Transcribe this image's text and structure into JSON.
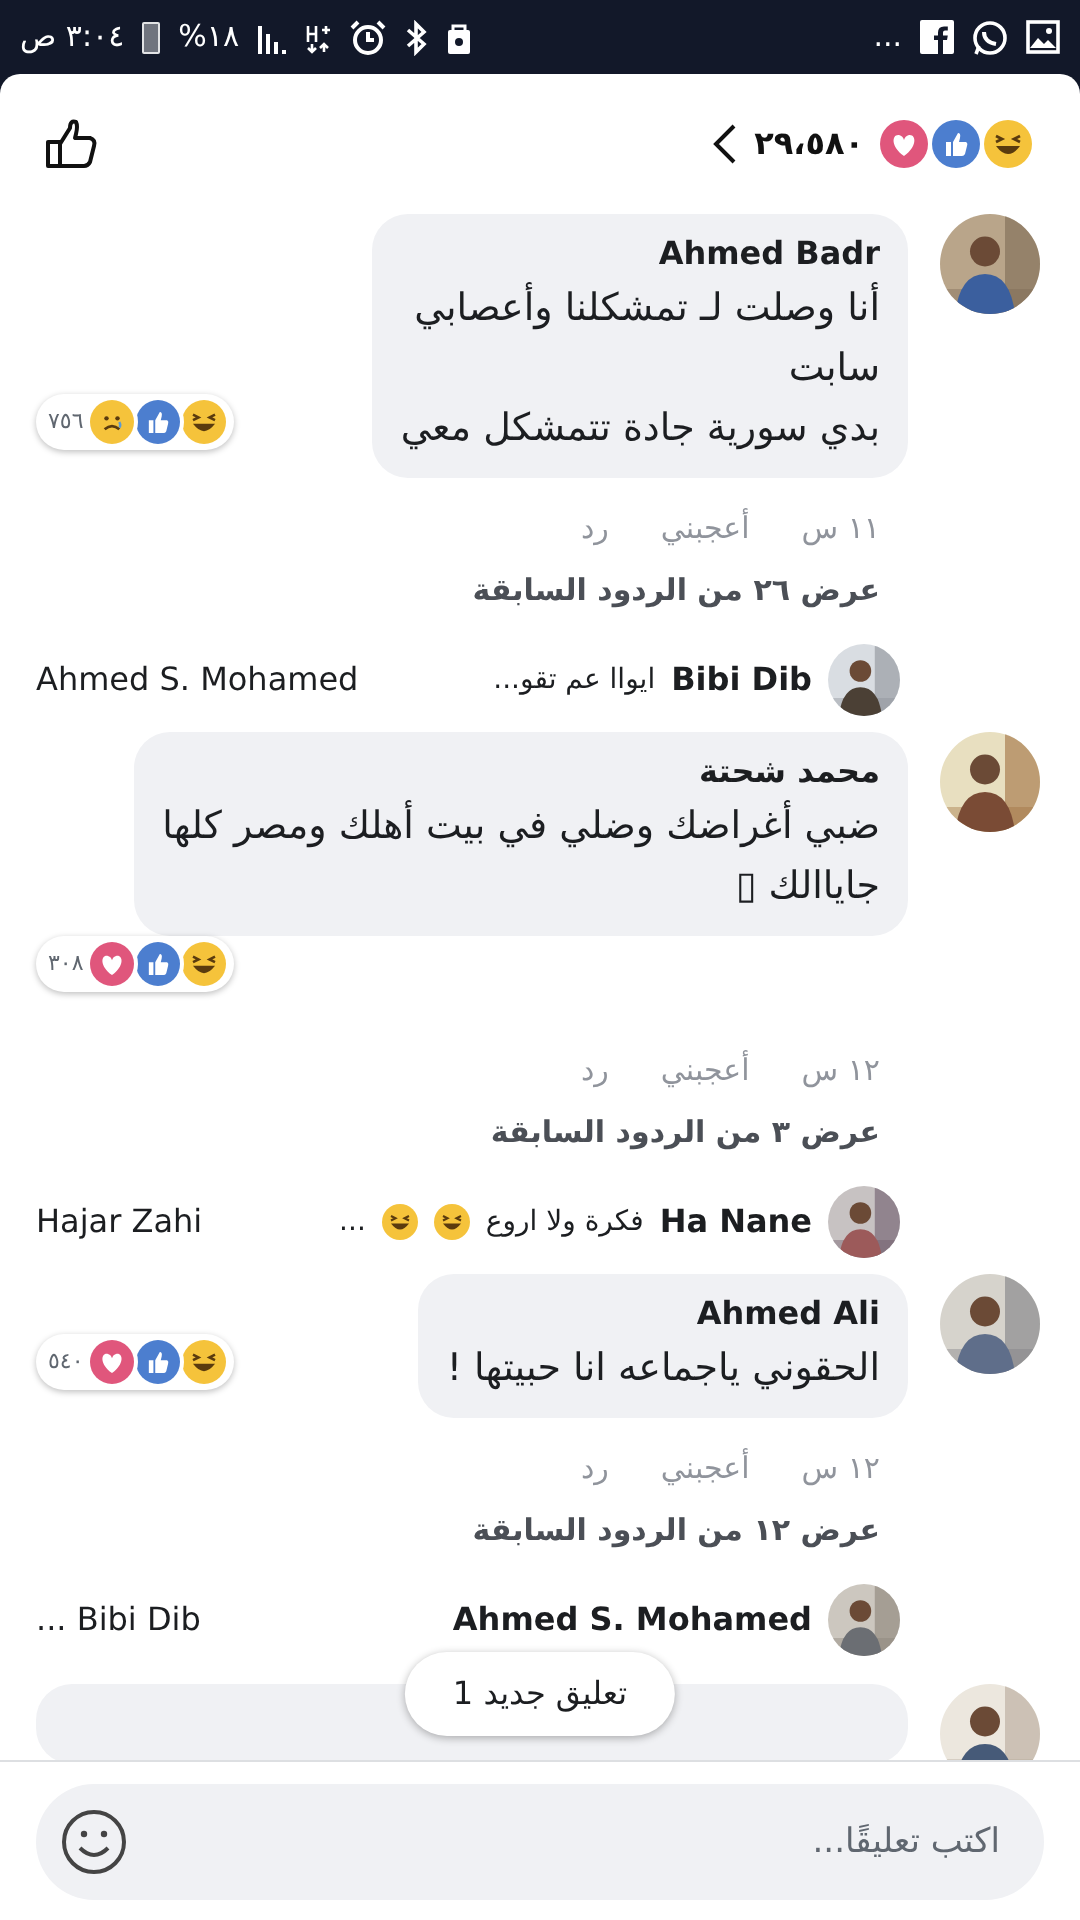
{
  "status_bar": {
    "time": "٣:٠٤ ص",
    "battery": "%١٨",
    "overflow": "..."
  },
  "header": {
    "reactions": [
      {
        "kind": "haha"
      },
      {
        "kind": "like"
      },
      {
        "kind": "love"
      }
    ],
    "count": "٢٩،٥٨٠"
  },
  "comments": [
    {
      "author": "Ahmed Badr",
      "text": "أنا وصلت لـ تمشكلنا وأعصابي\nسابت\nبدي سورية جادة تتمشكل معي",
      "reactions": [
        {
          "kind": "haha"
        },
        {
          "kind": "like"
        },
        {
          "kind": "sad"
        }
      ],
      "reaction_count": "٧٥٦",
      "time": "١١ س",
      "like": "أعجبني",
      "reply": "رد",
      "more_replies": "عرض ٢٦ من الردود السابقة",
      "reply_preview": {
        "author": "Bibi Dib",
        "snippet": "ايواا عم تقو...",
        "other": "Ahmed S. Mohamed"
      }
    },
    {
      "author": "محمد شحتة",
      "text": "ضبي أغراضك وضلي في بيت أهلك ومصر كلها\nجاياالك ▯",
      "reactions": [
        {
          "kind": "haha"
        },
        {
          "kind": "like"
        },
        {
          "kind": "love"
        }
      ],
      "reaction_count": "٣٠٨",
      "time": "١٢ س",
      "like": "أعجبني",
      "reply": "رد",
      "more_replies": "عرض ٣ من الردود السابقة",
      "reply_preview": {
        "author": "Ha Nane",
        "snippet": "فكرة ولا اروع",
        "emojis": [
          {
            "kind": "haha"
          },
          {
            "kind": "haha"
          }
        ],
        "ellipsis": "...",
        "other": "Hajar Zahi"
      }
    },
    {
      "author": "Ahmed Ali",
      "text": "الحقوني ياجماعه انا حبيتها !",
      "reactions": [
        {
          "kind": "haha"
        },
        {
          "kind": "like"
        },
        {
          "kind": "love"
        }
      ],
      "reaction_count": "٥٤٠",
      "time": "١٢ س",
      "like": "أعجبني",
      "reply": "رد",
      "more_replies": "عرض ١٢ من الردود السابقة",
      "reply_preview": {
        "author": "Ahmed S. Mohamed",
        "other": "Bibi Dib ..."
      }
    }
  ],
  "new_comments_pill": "1 تعليق جديد",
  "composer": {
    "placeholder": "اكتب تعليقًا..."
  }
}
